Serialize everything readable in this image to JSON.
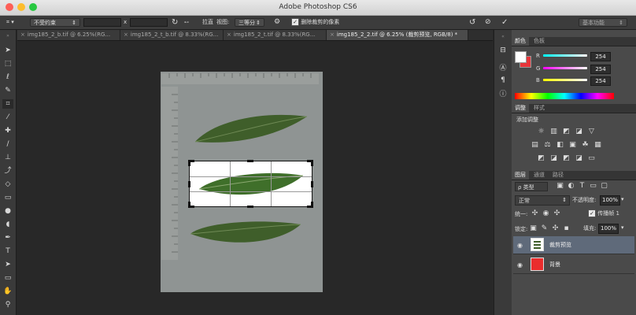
{
  "app": {
    "title": "Adobe Photoshop CS6"
  },
  "colors": {
    "traffic_red": "#fd5f57",
    "traffic_yellow": "#fdbd2e",
    "traffic_green": "#27c840",
    "foreground_swatch": "#ffffff",
    "background_swatch": "#e8353a",
    "layer_bg_fill": "#ea2d2d",
    "leaf_green": "#3f5e2a"
  },
  "options_bar": {
    "tool_icon": "crop-icon",
    "ratio_select": "不受约束",
    "x_label": "x",
    "straighten_label": "拉直",
    "view_label": "视图:",
    "view_select": "三等分",
    "delete_cropped_label": "删除裁剪的像素",
    "delete_cropped_checked": true,
    "workspace_select": "基本功能"
  },
  "tabs": [
    {
      "label": "img185_2_b.tif @ 6.25%(RG...",
      "active": false
    },
    {
      "label": "img185_2_t_b.tif @ 8.33%(RG...",
      "active": false
    },
    {
      "label": "img185_2_t.tif @ 8.33%(RG...",
      "active": false
    },
    {
      "label": "img185_2_2.tif @ 6.25% (裁剪预览, RGB/8) *",
      "active": true
    }
  ],
  "color_panel": {
    "tabs": [
      "颜色",
      "色板"
    ],
    "active_tab": "颜色",
    "channels": [
      {
        "label": "R",
        "value": "254",
        "level": 0.996
      },
      {
        "label": "G",
        "value": "254",
        "level": 0.996
      },
      {
        "label": "B",
        "value": "254",
        "level": 0.996
      }
    ]
  },
  "adjustments_panel": {
    "tabs": [
      "调整",
      "样式"
    ],
    "active_tab": "调整",
    "heading": "添加调整"
  },
  "layers_panel": {
    "tabs": [
      "图层",
      "通道",
      "路径"
    ],
    "active_tab": "图层",
    "filter_label": "ρ 类型",
    "blend_mode": "正常",
    "opacity_label": "不透明度:",
    "opacity_value": "100%",
    "unify_label": "统一:",
    "propagate_label": "传播帧 1",
    "lock_label": "锁定:",
    "fill_label": "填充:",
    "fill_value": "100%",
    "layers": [
      {
        "name": "裁剪预览",
        "selected": true
      },
      {
        "name": "背景",
        "selected": false
      }
    ]
  }
}
